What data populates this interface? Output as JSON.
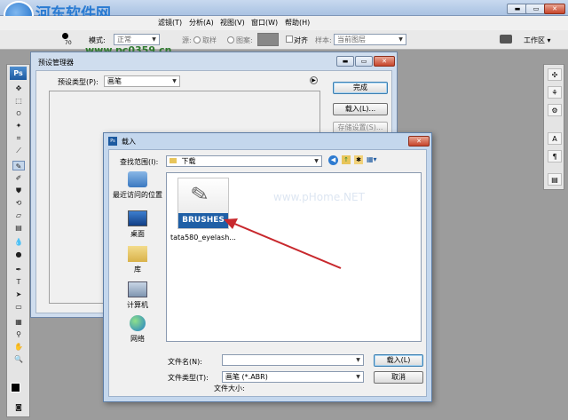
{
  "app": {
    "watermark": "河东软件网",
    "watermark_url": "www.pc0359.cn",
    "menu": [
      "滤镜(T)",
      "分析(A)",
      "视图(V)",
      "窗口(W)",
      "帮助(H)"
    ],
    "workspace": "工作区 ▾"
  },
  "options_bar": {
    "brush_size": "70",
    "mode_label": "模式:",
    "mode_value": "正常",
    "water_label": "源:",
    "sampled": "取样",
    "pattern": "图案:",
    "aligned": "对齐",
    "sample_label": "样本:",
    "sample_value": "当前图层"
  },
  "preset_manager": {
    "title": "预设管理器",
    "type_label": "预设类型(P):",
    "type_value": "画笔",
    "done": "完成",
    "load": "载入(L)...",
    "save": "存储设置(S)..."
  },
  "load_dialog": {
    "title": "载入",
    "lookin_label": "查找范围(I):",
    "lookin_value": "下载",
    "places": [
      "最近访问的位置",
      "桌面",
      "库",
      "计算机",
      "网络"
    ],
    "file": {
      "name": "tata580_eyelash...",
      "thumb_label": "BRUSHES"
    },
    "faint_watermark": "www.pHome.NET",
    "filename_label": "文件名(N):",
    "filename_value": "",
    "filetype_label": "文件类型(T):",
    "filetype_value": "画笔 (*.ABR)",
    "load_button": "载入(L)",
    "cancel_button": "取消",
    "filesize_label": "文件大小:"
  },
  "colors": {
    "arrow": "#c8282d",
    "thumb_blue": "#1f5fa6"
  }
}
